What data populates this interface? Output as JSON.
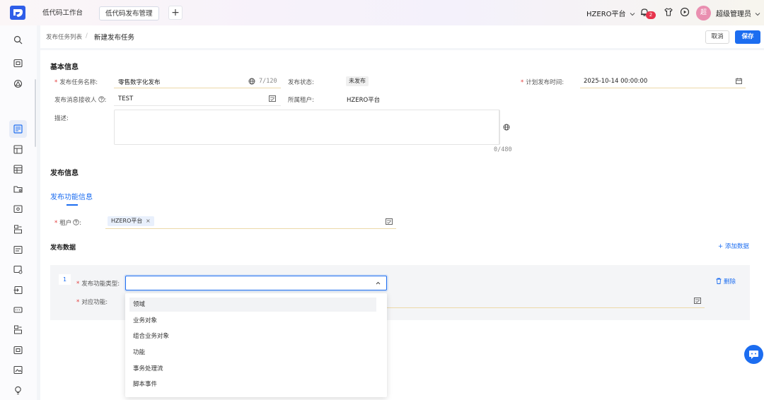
{
  "topbar": {
    "tabs": [
      {
        "label": "低代码工作台"
      },
      {
        "label": "低代码发布管理"
      }
    ],
    "add_tab": "+",
    "tenant": "HZERO平台",
    "notification_count": "2",
    "avatar_initial": "超",
    "username": "超级管理员"
  },
  "breadcrumb": {
    "parent": "发布任务列表",
    "separator": "/",
    "current": "新建发布任务"
  },
  "actions": {
    "cancel": "取消",
    "save": "保存"
  },
  "basic_info": {
    "title": "基本信息",
    "task_name_label": "发布任务名称:",
    "task_name_value": "零售数字化发布",
    "task_name_counter": "7/120",
    "status_label": "发布状态:",
    "status_value": "未发布",
    "plan_time_label": "计划发布时间:",
    "plan_time_value": "2025-10-14 00:00:00",
    "receiver_label": "发布消息接收人",
    "receiver_value": "TEST",
    "tenant_label": "所属租户:",
    "tenant_value": "HZERO平台",
    "desc_label": "描述:",
    "desc_counter": "0/480"
  },
  "publish_info": {
    "title": "发布信息",
    "subtab": "发布功能信息",
    "tenant_label": "租户",
    "tenant_tag": "HZERO平台",
    "tag_close": "×"
  },
  "publish_data": {
    "title": "发布数据",
    "add_label": "添加数据",
    "rows": [
      {
        "index": "1",
        "type_label": "发布功能类型:",
        "function_label": "对应功能:",
        "delete_label": "删除"
      }
    ]
  },
  "dropdown": {
    "options": [
      "领域",
      "业务对象",
      "组合业务对象",
      "功能",
      "事务处理流",
      "脚本事件"
    ],
    "highlighted_index": 0
  },
  "colors": {
    "primary": "#1c6df0",
    "required": "#e23b3b",
    "field_underline": "#ecd9a8"
  }
}
